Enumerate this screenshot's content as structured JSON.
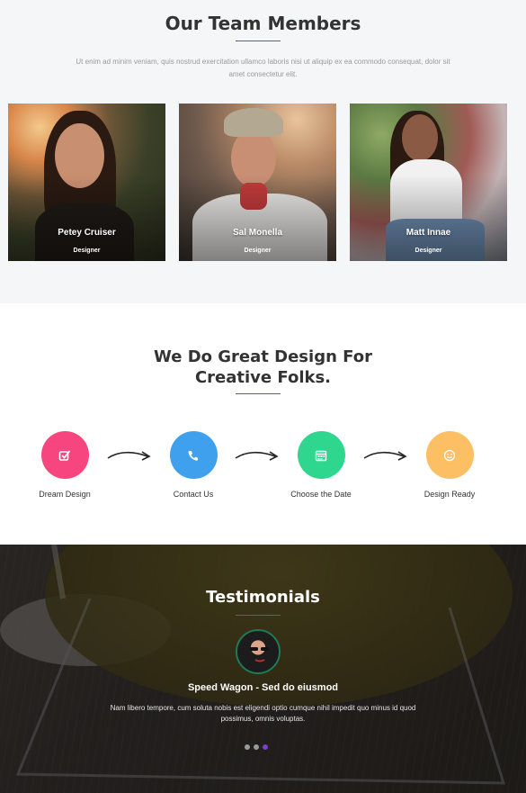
{
  "team": {
    "title": "Our Team Members",
    "intro": "Ut enim ad minim veniam, quis nostrud exercitation ullamco laboris nisi ut aliquip ex ea commodo consequat, dolor sit amet consectetur elit.",
    "members": [
      {
        "name": "Petey Cruiser",
        "role": "Designer"
      },
      {
        "name": "Sal Monella",
        "role": "Designer"
      },
      {
        "name": "Matt Innae",
        "role": "Designer"
      }
    ]
  },
  "process": {
    "title": "We Do Great Design For Creative Folks.",
    "steps": [
      {
        "label": "Dream Design",
        "icon": "check-square-icon",
        "color": "#f7467f"
      },
      {
        "label": "Contact Us",
        "icon": "phone-icon",
        "color": "#3fa1ee"
      },
      {
        "label": "Choose the Date",
        "icon": "calendar-icon",
        "color": "#2fd68e"
      },
      {
        "label": "Design Ready",
        "icon": "smile-icon",
        "color": "#fdbf63"
      }
    ]
  },
  "testimonials": {
    "title": "Testimonials",
    "author": "Speed Wagon - Sed do eiusmod",
    "quote": "Nam libero tempore, cum soluta nobis est eligendi optio cumque nihil impedit quo minus id quod possimus, omnis voluptas.",
    "active_slide": 3,
    "slide_count": 3
  },
  "colors": {
    "accent": "#7b3fcf"
  }
}
